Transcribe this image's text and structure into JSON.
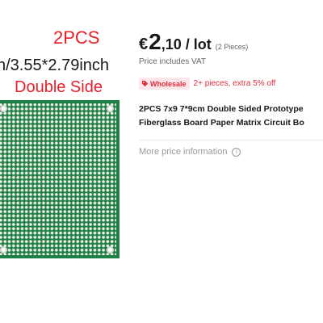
{
  "image": {
    "qty_text": "2PCS",
    "size_text": "n/3.55*2.79inch",
    "side_text": "Double Side",
    "board_color": "#1c7f45",
    "label_accent": "#e8202a"
  },
  "price": {
    "currency": "€",
    "major": "2",
    "minor": ",10",
    "unit": "/ lot",
    "pieces_note": "(2 Pieces)",
    "vat_note": "Price includes VAT"
  },
  "wholesale": {
    "badge_icon": "tag-icon",
    "badge_label": "Wholesale",
    "text": "2+ pieces, extra 5% off",
    "accent": "#e02e3d"
  },
  "product": {
    "title_line1": "2PCS 7x9 7*9cm Double Sided Prototype",
    "title_line2": "Fiberglass Board Paper Matrix Circuit Bo"
  },
  "more_price": {
    "label": "More price information",
    "icon": "info-icon"
  }
}
